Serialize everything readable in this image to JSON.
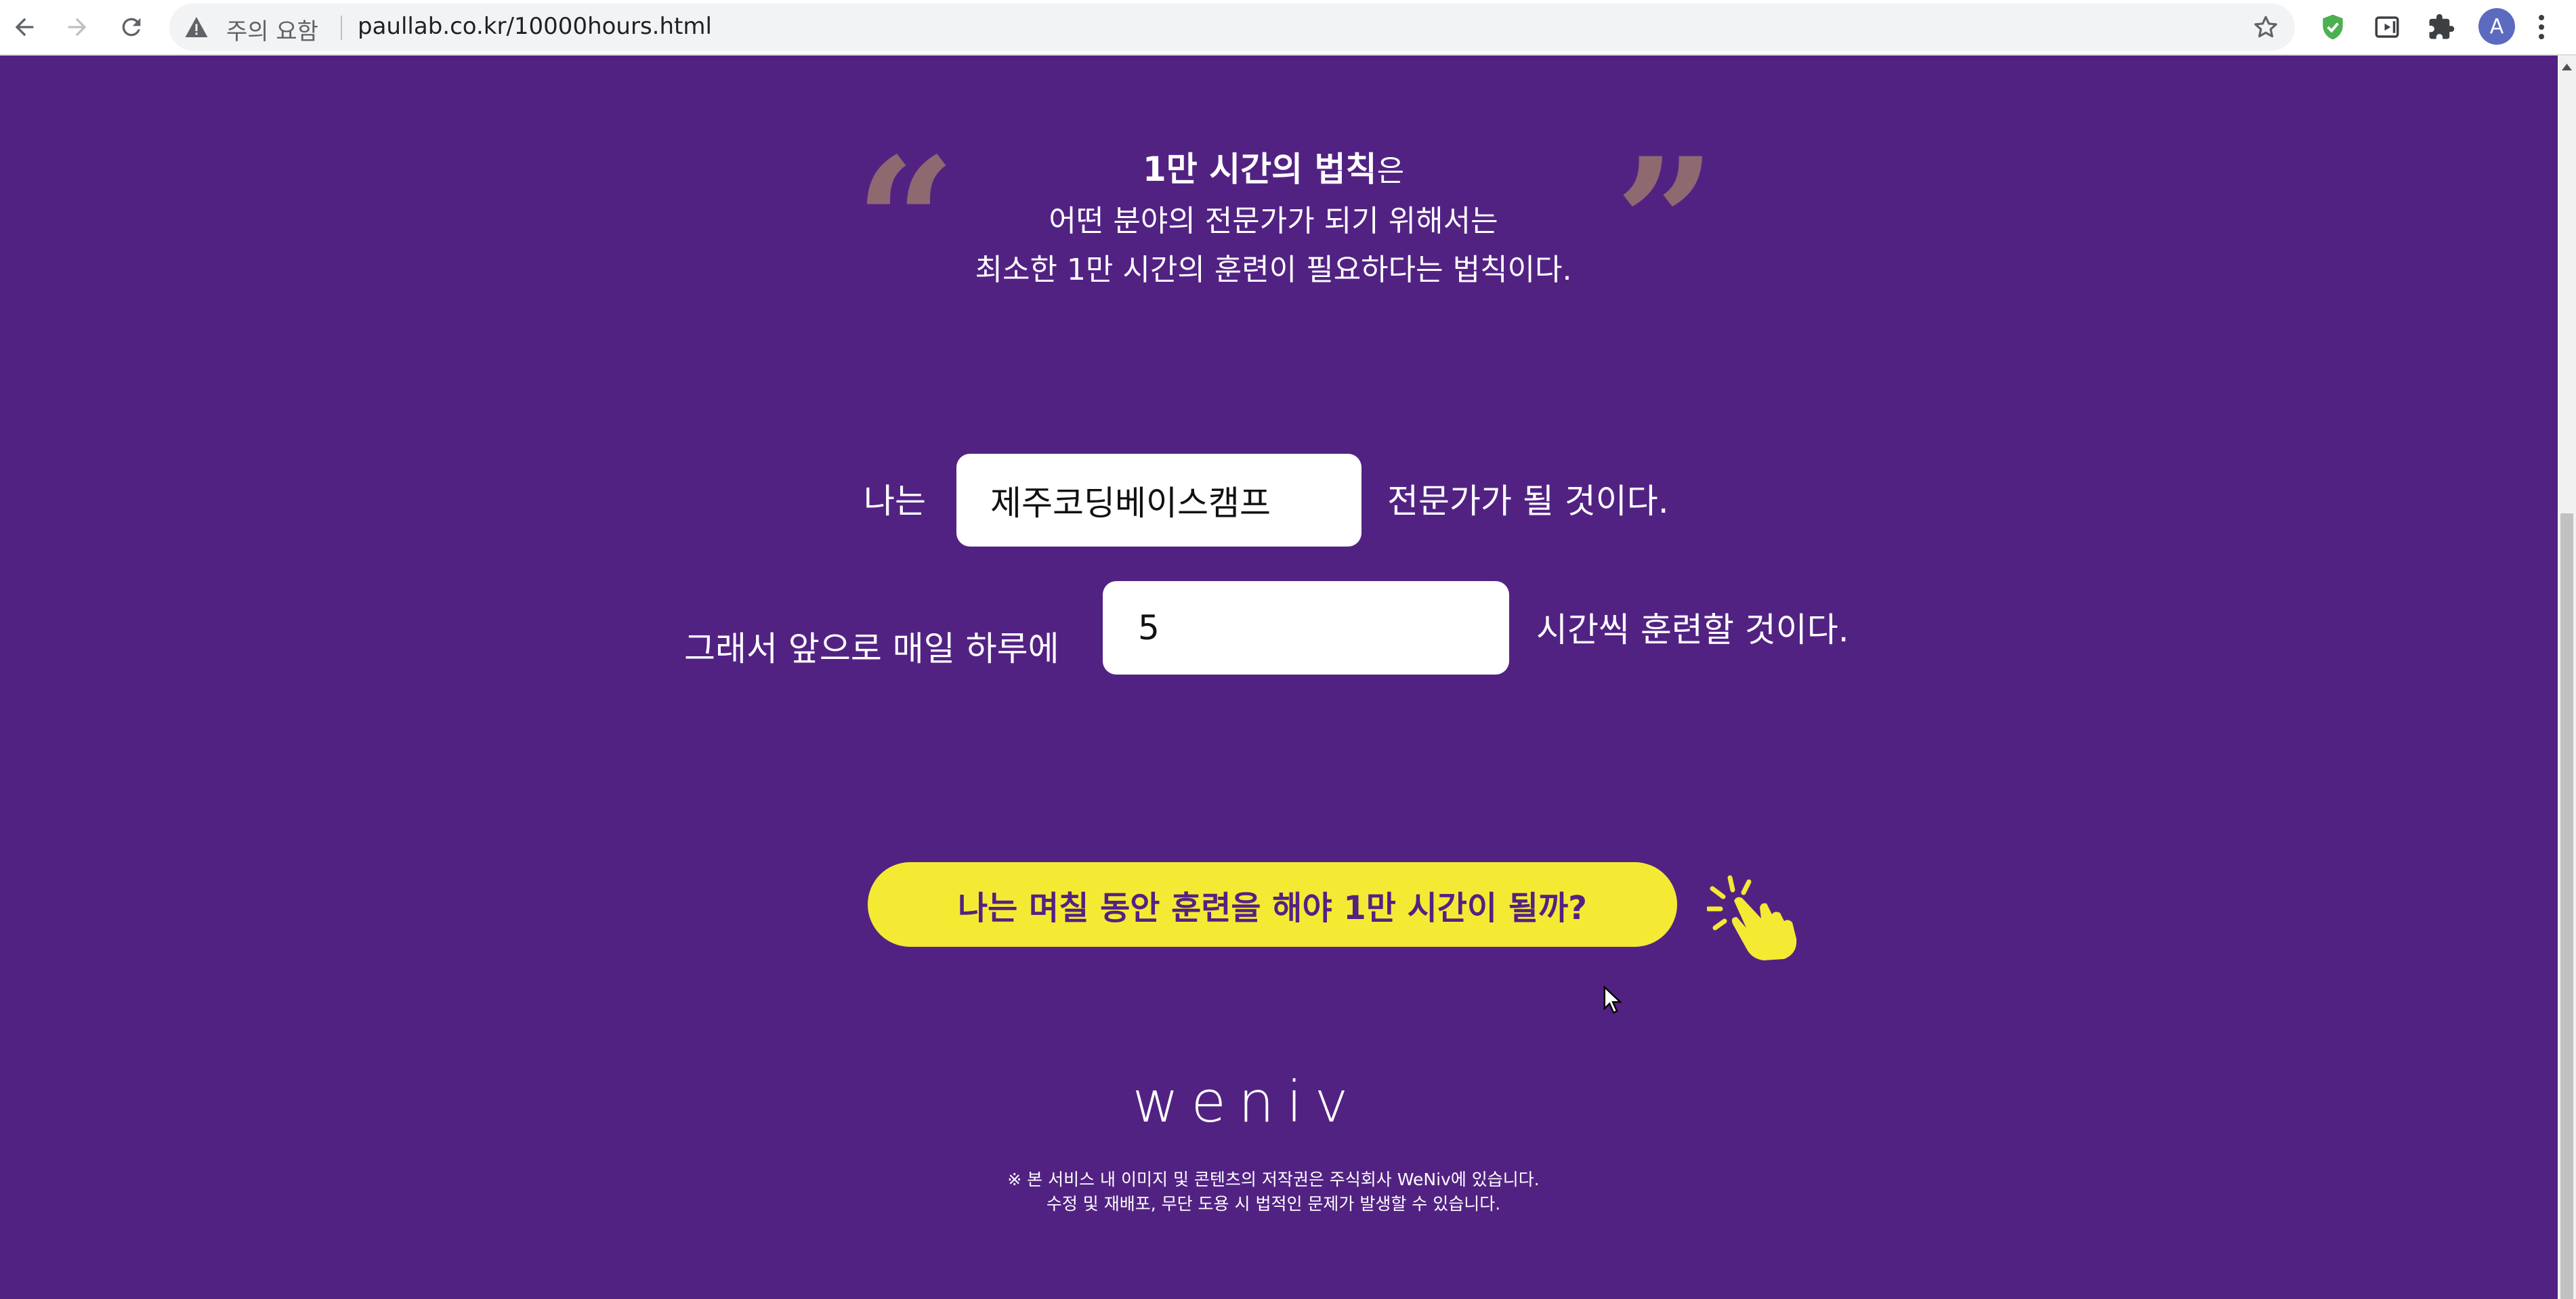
{
  "browser": {
    "security_warning": "주의 요함",
    "url": "paullab.co.kr/10000hours.html",
    "avatar_letter": "A"
  },
  "intro": {
    "title_bold": "1만 시간의 법칙",
    "title_suffix": "은",
    "line2": "어떤 분야의 전문가가 되기 위해서는",
    "line3": "최소한 1만 시간의 훈련이 필요하다는 법칙이다.",
    "open_quote": "“",
    "close_quote": "”"
  },
  "form": {
    "field_prefix": "나는",
    "field_value": "제주코딩베이스캠프",
    "field_suffix": "전문가가 될 것이다.",
    "hours_prefix": "그래서 앞으로 매일 하루에",
    "hours_value": "5",
    "hours_suffix": "시간씩 훈련할 것이다."
  },
  "cta": {
    "label": "나는 며칠 동안 훈련을 해야 1만 시간이 될까?"
  },
  "footer": {
    "logo": "weniv",
    "copyright_line1": "※ 본 서비스 내 이미지 및 콘텐츠의 저작권은 주식회사 WeNiv에 있습니다.",
    "copyright_line2": "수정 및 재배포, 무단 도용 시 법적인 문제가 발생할 수 있습니다."
  },
  "colors": {
    "background": "#522283",
    "cta_background": "#f5ea33",
    "quote_mark": "#8e6a70"
  },
  "icons": [
    "back-arrow-icon",
    "forward-arrow-icon",
    "reload-icon",
    "warning-icon",
    "star-icon",
    "shield-check-icon",
    "media-icon",
    "puzzle-icon",
    "kebab-menu-icon",
    "clicking-hand-icon",
    "mouse-cursor-icon"
  ]
}
